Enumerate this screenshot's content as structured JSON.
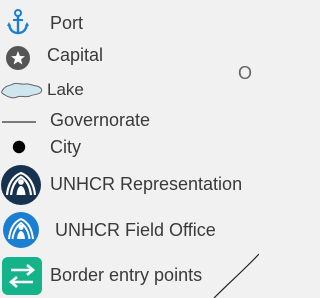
{
  "legend": {
    "items": [
      {
        "label": "Port",
        "icon": "anchor-icon"
      },
      {
        "label": "Capital",
        "icon": "capital-star-icon"
      },
      {
        "label": "Lake",
        "icon": "lake-icon"
      },
      {
        "label": "Governorate",
        "icon": "governorate-line-icon"
      },
      {
        "label": "City",
        "icon": "city-dot-icon"
      },
      {
        "label": "UNHCR Representation",
        "icon": "unhcr-representation-icon"
      },
      {
        "label": "UNHCR Field Office",
        "icon": "unhcr-field-office-icon"
      },
      {
        "label": "Border entry points",
        "icon": "border-entry-icon"
      }
    ]
  },
  "map_fragment": {
    "text": "O"
  },
  "colors": {
    "port": "#1b7fd1",
    "capital": "#555555",
    "lake": "#cfe6ee",
    "governorate": "#333333",
    "city": "#000000",
    "unhcr_representation": "#17324f",
    "unhcr_field_office": "#1b7fd1",
    "border_entry": "#14b38a",
    "boundary": "#222222"
  }
}
